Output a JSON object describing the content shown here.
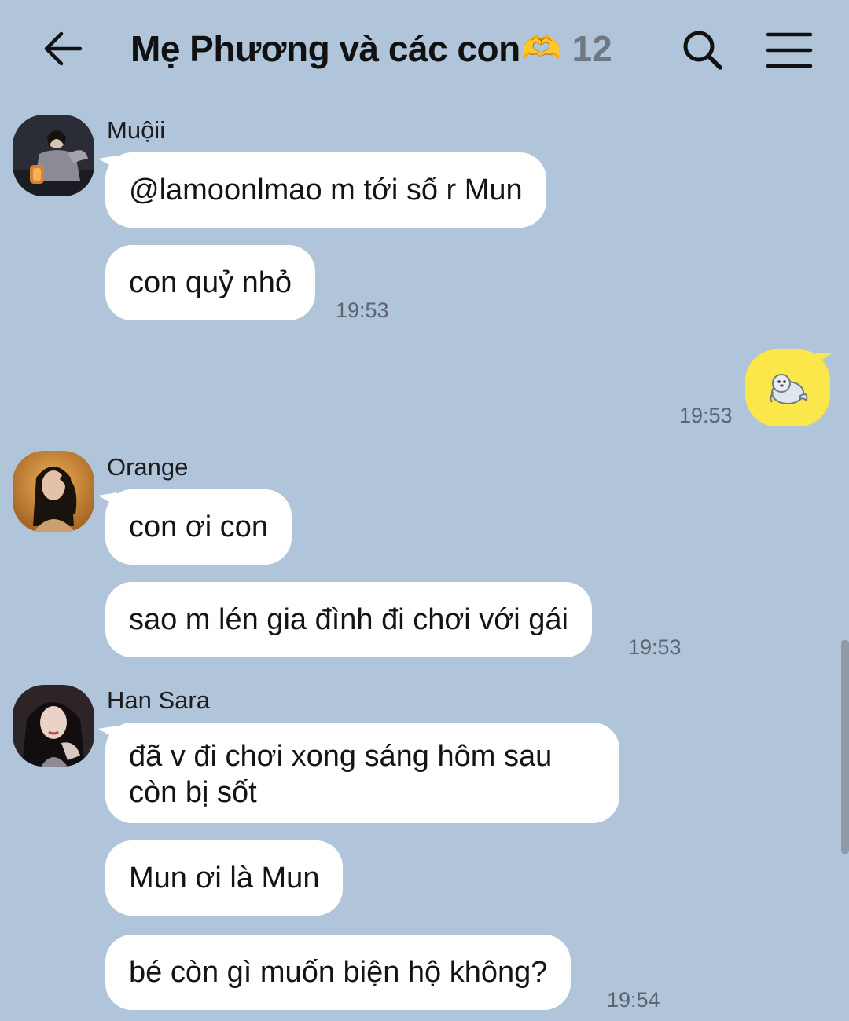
{
  "header": {
    "title": "Mẹ Phương và các con",
    "title_emoji": "🫶",
    "member_count": "12"
  },
  "messages": [
    {
      "sender": "Muộii",
      "texts": [
        "@lamoonlmao m tới số r Mun",
        "con quỷ nhỏ"
      ],
      "time": "19:53"
    },
    {
      "sender": "me",
      "sticker": "seal-sticker",
      "time": "19:53"
    },
    {
      "sender": "Orange",
      "texts": [
        "con ơi con",
        "sao m lén gia đình đi chơi với gái"
      ],
      "time": "19:53"
    },
    {
      "sender": "Han Sara",
      "texts": [
        "đã v đi chơi xong sáng hôm sau còn bị sốt",
        "Mun ơi là Mun",
        "bé còn gì muốn biện hộ không?"
      ],
      "time": "19:54"
    }
  ],
  "colors": {
    "background": "#b0c4da",
    "incoming_bubble": "#ffffff",
    "outgoing_bubble": "#fbe74a",
    "member_count": "#6f7780"
  },
  "icons": [
    "back-arrow-icon",
    "search-icon",
    "menu-icon",
    "seal-sticker"
  ]
}
